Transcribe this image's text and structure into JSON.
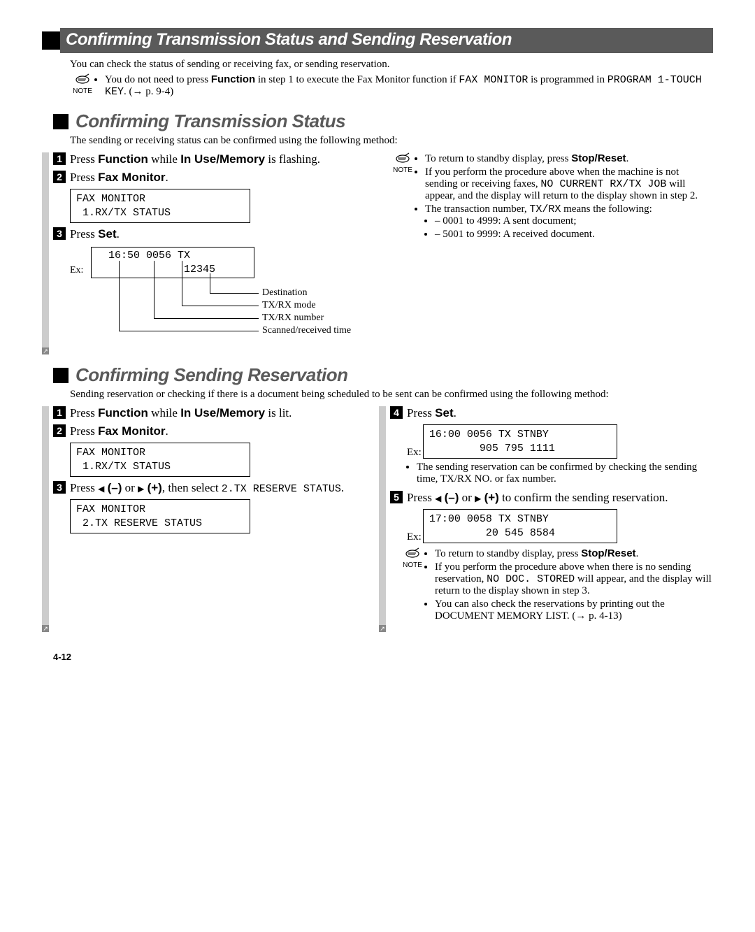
{
  "banner": {
    "title": "Confirming Transmission Status and Sending Reservation"
  },
  "intro": "You can check the status of sending or receiving fax, or sending reservation.",
  "note_label": "NOTE",
  "top_note": {
    "text_a": "You do not need to press ",
    "bold1": "Function",
    "text_b": " in step 1 to execute the Fax Monitor function if ",
    "mono1": "FAX MONITOR",
    "text_c": " is programmed in ",
    "mono2": "PROGRAM 1-TOUCH KEY",
    "text_d": ". (→ p. 9-4)"
  },
  "section1": {
    "heading": "Confirming Transmission Status",
    "desc": "The sending or receiving status can be confirmed using the following method:",
    "left": {
      "step1_a": "Press ",
      "step1_b1": "Function",
      "step1_c": " while ",
      "step1_b2": "In Use/Memory",
      "step1_d": " is flashing.",
      "step2_a": "Press ",
      "step2_b": "Fax Monitor",
      "step2_c": ".",
      "lcd1": "FAX MONITOR\n 1.RX/TX STATUS",
      "step3_a": "Press ",
      "step3_b": "Set",
      "step3_c": ".",
      "ex": "Ex:",
      "diag_lcd": "  16:50 0056 TX\n              12345",
      "lbl_dest": "Destination",
      "lbl_mode": "TX/RX mode",
      "lbl_num": "TX/RX number",
      "lbl_time": "Scanned/received time"
    },
    "right": {
      "note1_a": "To return to standby display, press ",
      "note1_b": "Stop/Reset",
      "note1_c": ".",
      "note2_a": "If you perform the procedure above when the machine is not sending or receiving faxes, ",
      "note2_mono": "NO CURRENT RX/TX JOB",
      "note2_b": " will appear, and the display will return to the display shown in step 2.",
      "note3_a": "The transaction number, ",
      "note3_mono": "TX/RX",
      "note3_b": " means the following:",
      "dash1": "0001 to 4999: A sent document;",
      "dash2": "5001 to 9999: A received document."
    }
  },
  "section2": {
    "heading": "Confirming Sending Reservation",
    "desc": "Sending reservation or checking if there is a document being scheduled to be sent can be confirmed using the following method:",
    "left": {
      "step1_a": "Press ",
      "step1_b1": "Function",
      "step1_c": " while ",
      "step1_b2": "In Use/Memory",
      "step1_d": " is lit.",
      "step2_a": "Press ",
      "step2_b": "Fax Monitor",
      "step2_c": ".",
      "lcd1": "FAX MONITOR\n 1.RX/TX STATUS",
      "step3_a": "Press ",
      "step3_mid": " or ",
      "step3_b": ", then select ",
      "step3_mono": "2.TX RESERVE STATUS",
      "step3_c": ".",
      "minus": "(–)",
      "plus": "(+)",
      "lcd2": "FAX MONITOR\n 2.TX RESERVE STATUS"
    },
    "right": {
      "step4_a": "Press ",
      "step4_b": "Set",
      "step4_c": ".",
      "ex": "Ex:",
      "lcd3": "16:00 0056 TX STNBY\n        905 795 1111",
      "sub4": "The sending reservation can be confirmed by checking the sending time, TX/RX NO. or fax number.",
      "step5_a": "Press ",
      "step5_mid": " or ",
      "step5_b": " to confirm the sending reservation.",
      "minus": "(–)",
      "plus": "(+)",
      "lcd4": "17:00 0058 TX STNBY\n         20 545 8584",
      "note1_a": "To return to standby display, press ",
      "note1_b": "Stop/Reset",
      "note1_c": ".",
      "note2_a": "If you perform the procedure above when there is no sending reservation, ",
      "note2_mono": "NO DOC. STORED",
      "note2_b": " will appear, and the display will return to the display shown in step 3.",
      "note3": "You can also check the reservations by printing out the DOCUMENT MEMORY LIST. (→ p. 4-13)"
    }
  },
  "page_num": "4-12"
}
